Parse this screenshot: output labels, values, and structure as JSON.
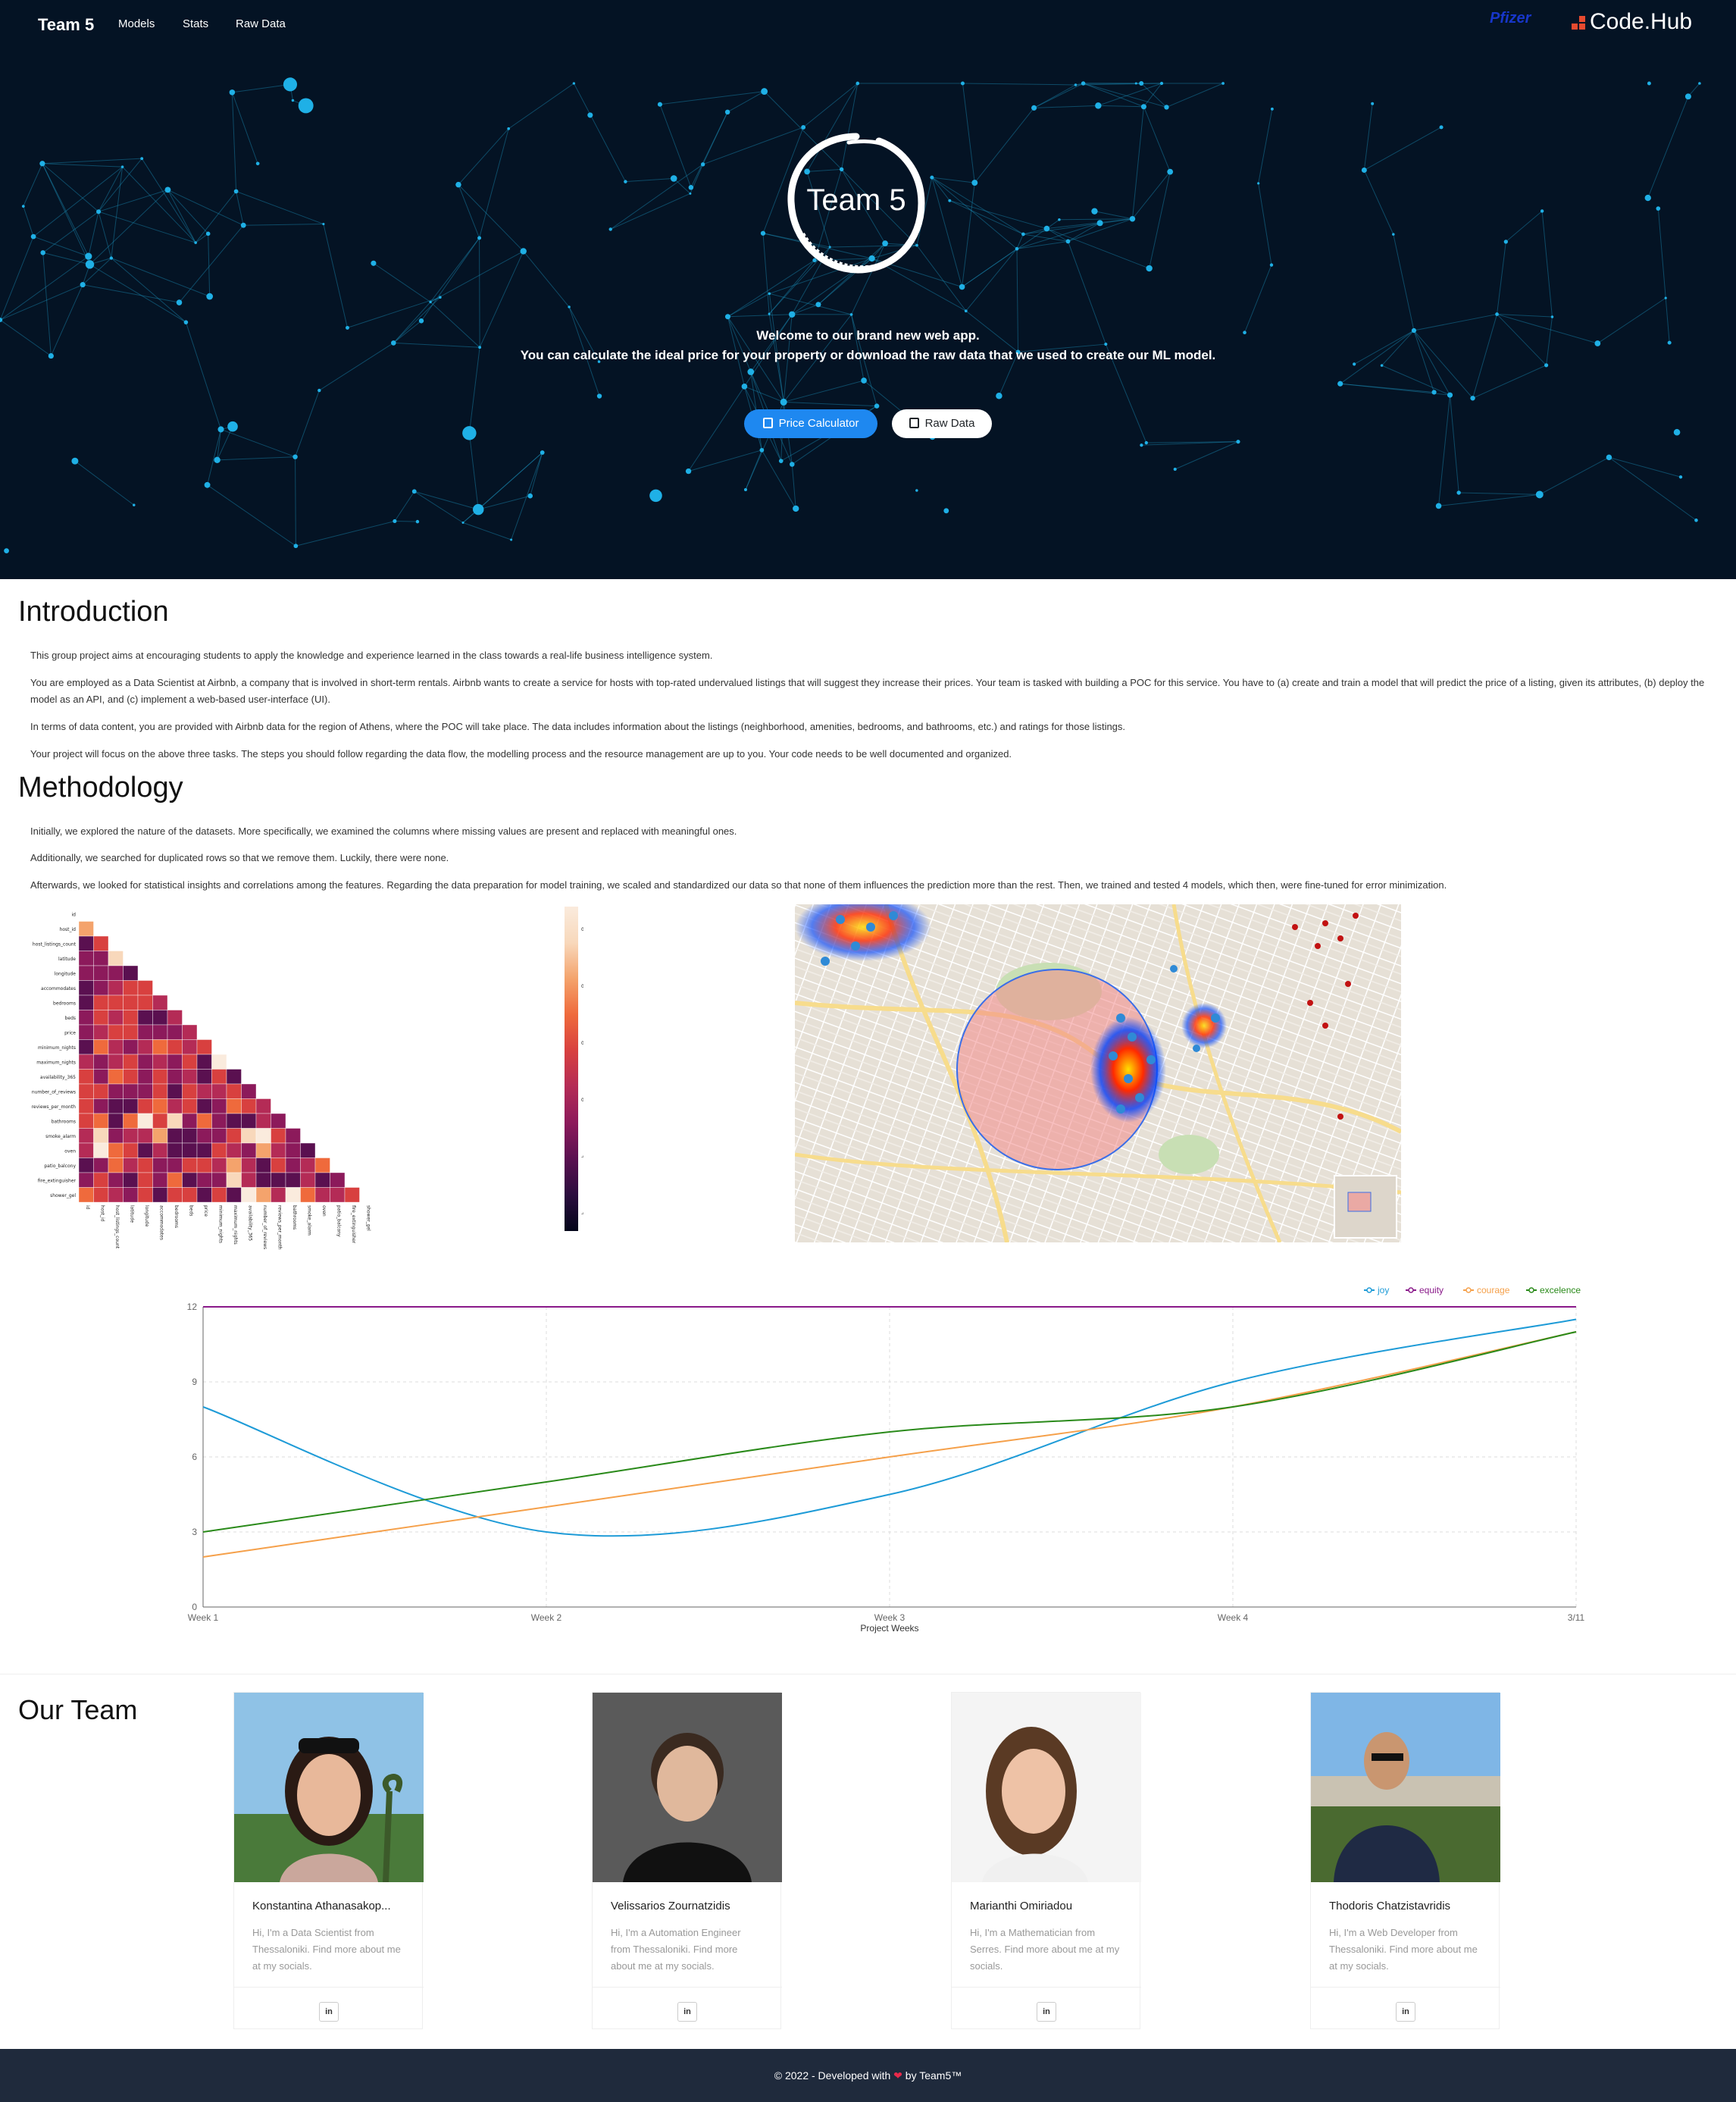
{
  "nav": {
    "brand": "Team 5",
    "links": [
      "Models",
      "Stats",
      "Raw Data"
    ],
    "partner_logos": [
      "Pfizer",
      "Code.Hub"
    ]
  },
  "hero": {
    "logo_text": "Team 5",
    "welcome_line1": "Welcome to our brand new web app.",
    "welcome_line2": "You can calculate the ideal price for your property or download the raw data that we used to create our ML model.",
    "btn_price": "Price Calculator",
    "btn_raw": "Raw Data"
  },
  "intro": {
    "title": "Introduction",
    "paragraphs": [
      "This group project aims at encouraging students to apply the knowledge and experience learned in the class towards a real-life business intelligence system.",
      "You are employed as a Data Scientist at Airbnb, a company that is involved in short-term rentals. Airbnb wants to create a service for hosts with top-rated undervalued listings that will suggest they increase their prices. Your team is tasked with building a POC for this service. You have to (a) create and train a model that will predict the price of a listing, given its attributes, (b) deploy the model as an API, and (c) implement a web-based user-interface (UI).",
      "In terms of data content, you are provided with Airbnb data for the region of Athens, where the POC will take place. The data includes information about the listings (neighborhood, amenities, bedrooms, and bathrooms, etc.) and ratings for those listings.",
      "Your project will focus on the above three tasks. The steps you should follow regarding the data flow, the modelling process and the resource management are up to you. Your code needs to be well documented and organized."
    ]
  },
  "methodology": {
    "title": "Methodology",
    "paragraphs": [
      "Initially, we explored the nature of the datasets. More specifically, we examined the columns where missing values are present and replaced with meaningful ones.",
      "Additionally, we searched for duplicated rows so that we remove them. Luckily, there were none.",
      "Afterwards, we looked for statistical insights and correlations among the features. Regarding the data preparation for model training, we scaled and standardized our data so that none of them influences the prediction more than the rest. Then, we trained and tested 4 models, which then, were fine-tuned for error minimization."
    ]
  },
  "heatmap": {
    "features": [
      "id",
      "host_id",
      "host_listings_count",
      "latitude",
      "longitude",
      "accommodates",
      "bedrooms",
      "beds",
      "price",
      "minimum_nights",
      "maximum_nights",
      "availability_365",
      "number_of_reviews",
      "reviews_per_month",
      "bathrooms",
      "smoke_alarm",
      "oven",
      "patio_balcony",
      "fire_extinguisher",
      "shower_gel"
    ],
    "colorbar_ticks": [
      "0.6",
      "0.4",
      "0.2",
      "0.0",
      "-0.2",
      "-0.4"
    ]
  },
  "chart_data": {
    "type": "line",
    "categories": [
      "Week 1",
      "Week 2",
      "Week 3",
      "Week 4",
      "3/11"
    ],
    "xlabel": "Project Weeks",
    "ylabel": "",
    "ylim": [
      0,
      12
    ],
    "yticks": [
      "0",
      "3",
      "6",
      "9",
      "12"
    ],
    "legend_position": "top-right",
    "series": [
      {
        "name": "joy",
        "color": "#1e9bd7",
        "values": [
          8,
          3,
          4.5,
          9,
          11.5
        ]
      },
      {
        "name": "equity",
        "color": "#8a1a8a",
        "values": [
          12,
          12,
          12,
          12,
          12
        ]
      },
      {
        "name": "courage",
        "color": "#f5a04a",
        "values": [
          2,
          4,
          6,
          8,
          11
        ]
      },
      {
        "name": "excelence",
        "color": "#2a8a1a",
        "values": [
          3,
          5,
          7,
          8,
          11
        ]
      }
    ]
  },
  "team": {
    "title": "Our Team",
    "members": [
      {
        "name": "Konstantina Athanasakop...",
        "bio": "Hi, I'm a Data Scientist from Thessaloniki. Find more about me at my socials.",
        "social": "in"
      },
      {
        "name": "Velissarios Zournatzidis",
        "bio": "Hi, I'm a Automation Engineer from Thessaloniki. Find more about me at my socials.",
        "social": "in"
      },
      {
        "name": "Marianthi Omiriadou",
        "bio": "Hi, I'm a Mathematician from Serres. Find more about me at my socials.",
        "social": "in"
      },
      {
        "name": "Thodoris Chatzistavridis",
        "bio": "Hi, I'm a Web Developer from Thessaloniki. Find more about me at my socials.",
        "social": "in"
      }
    ]
  },
  "footer": {
    "prefix": "© 2022 - Developed with",
    "heart": "❤",
    "suffix": "by Team5™"
  }
}
